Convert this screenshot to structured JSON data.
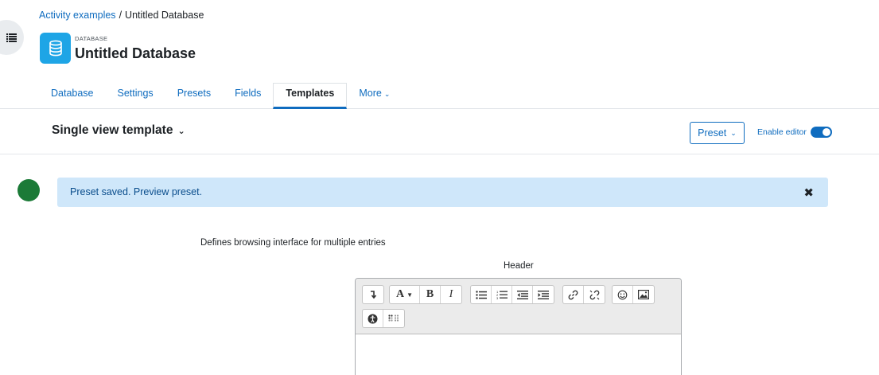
{
  "breadcrumb": {
    "parent": "Activity examples",
    "separator": "/",
    "current": "Untitled Database"
  },
  "header": {
    "kicker": "DATABASE",
    "title": "Untitled Database",
    "icon": "database-icon",
    "icon_color": "#1ea5e6"
  },
  "tabs": [
    {
      "label": "Database",
      "active": false
    },
    {
      "label": "Settings",
      "active": false
    },
    {
      "label": "Presets",
      "active": false
    },
    {
      "label": "Fields",
      "active": false
    },
    {
      "label": "Templates",
      "active": true
    },
    {
      "label": "More",
      "active": false
    }
  ],
  "template_selector": {
    "label": "Single view template"
  },
  "preset_button": {
    "label": "Preset"
  },
  "enable_editor": {
    "label": "Enable editor",
    "checked": true
  },
  "alert": {
    "text": "Preset saved. Preview preset."
  },
  "content": {
    "description": "Defines browsing interface for multiple entries",
    "section_label": "Header"
  },
  "colors": {
    "link": "#0f6cbf",
    "alert_bg": "#cfe7fa",
    "status_dot": "#1b7a37"
  },
  "editor_toolbar": {
    "font_button_label": "A",
    "bold_label": "B",
    "italic_label": "I"
  }
}
